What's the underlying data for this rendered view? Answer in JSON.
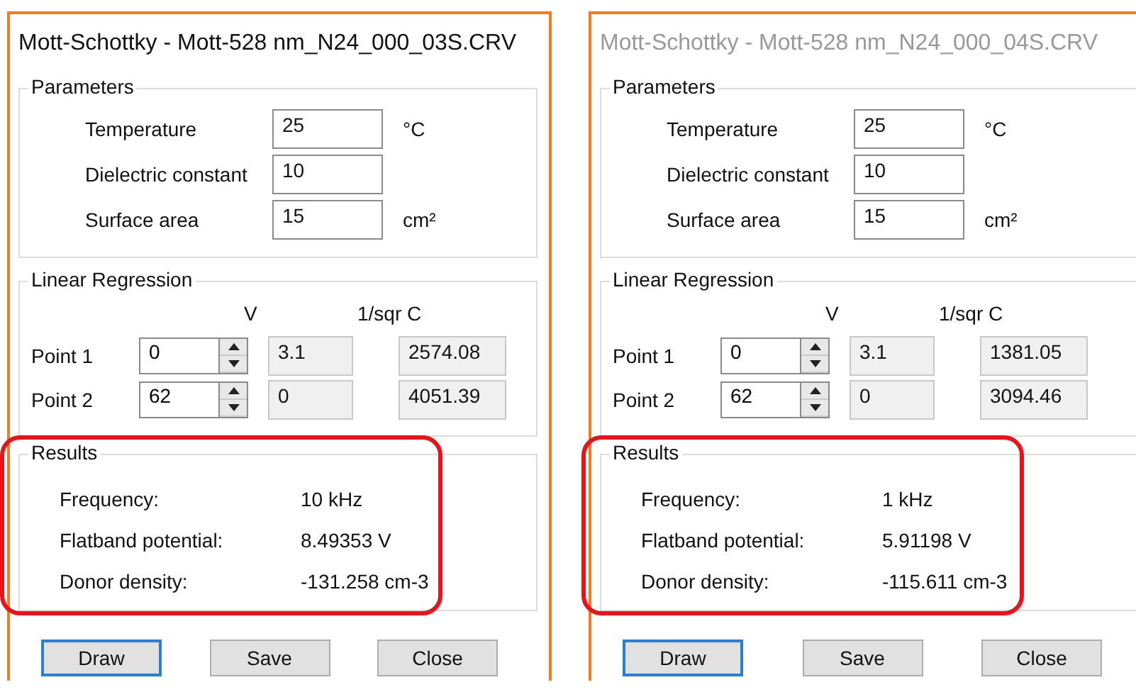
{
  "dialogs": [
    {
      "title": "Mott-Schottky - Mott-528 nm_N24_000_03S.CRV",
      "active": true,
      "parameters": {
        "title": "Parameters",
        "rows": [
          {
            "label": "Temperature",
            "value": "25",
            "unit": "°C"
          },
          {
            "label": "Dielectric constant",
            "value": "10"
          },
          {
            "label": "Surface area",
            "value": "15",
            "unit": "cm²"
          }
        ]
      },
      "regression": {
        "title": "Linear Regression",
        "columns": [
          "V",
          "1/sqr C"
        ],
        "points": [
          {
            "label": "Point 1",
            "index": "0",
            "v": "3.1",
            "c": "2574.08"
          },
          {
            "label": "Point 2",
            "index": "62",
            "v": "0",
            "c": "4051.39"
          }
        ]
      },
      "results": {
        "title": "Results",
        "highlighted": true,
        "rows": [
          {
            "label": "Frequency:",
            "value": "10 kHz"
          },
          {
            "label": "Flatband potential:",
            "value": "8.49353 V"
          },
          {
            "label": "Donor density:",
            "value": "-131.258 cm-3"
          }
        ]
      },
      "buttons": [
        {
          "label": "Draw",
          "default": true
        },
        {
          "label": "Save",
          "default": false
        },
        {
          "label": "Close",
          "default": false
        }
      ]
    },
    {
      "title": "Mott-Schottky - Mott-528 nm_N24_000_04S.CRV",
      "active": false,
      "parameters": {
        "title": "Parameters",
        "rows": [
          {
            "label": "Temperature",
            "value": "25",
            "unit": "°C"
          },
          {
            "label": "Dielectric constant",
            "value": "10"
          },
          {
            "label": "Surface area",
            "value": "15",
            "unit": "cm²"
          }
        ]
      },
      "regression": {
        "title": "Linear Regression",
        "columns": [
          "V",
          "1/sqr C"
        ],
        "points": [
          {
            "label": "Point 1",
            "index": "0",
            "v": "3.1",
            "c": "1381.05"
          },
          {
            "label": "Point 2",
            "index": "62",
            "v": "0",
            "c": "3094.46"
          }
        ]
      },
      "results": {
        "title": "Results",
        "highlighted": true,
        "rows": [
          {
            "label": "Frequency:",
            "value": "1 kHz"
          },
          {
            "label": "Flatband potential:",
            "value": "5.91198 V"
          },
          {
            "label": "Donor density:",
            "value": "-115.611 cm-3"
          }
        ]
      },
      "buttons": [
        {
          "label": "Draw",
          "default": true
        },
        {
          "label": "Save",
          "default": false
        },
        {
          "label": "Close",
          "default": false
        }
      ]
    }
  ]
}
